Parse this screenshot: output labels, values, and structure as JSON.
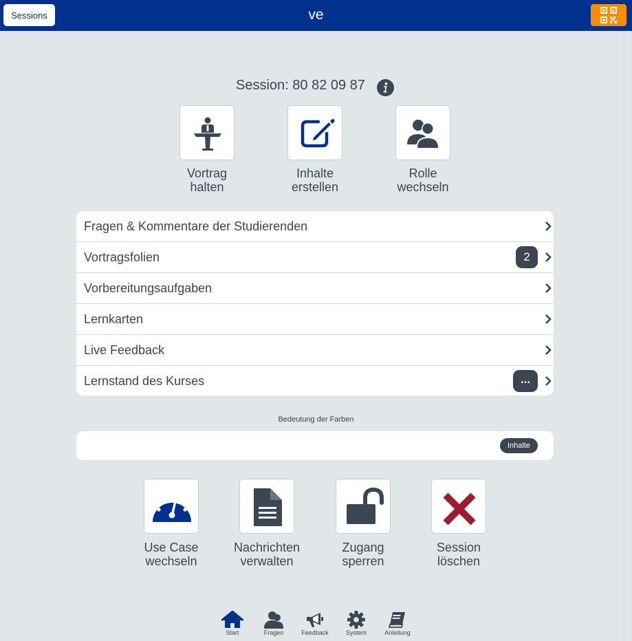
{
  "header": {
    "sessions_button": "Sessions",
    "title": "ve",
    "qr_icon": "qr-code-icon"
  },
  "session": {
    "label": "Session: 80 82 09 87",
    "info_icon": "info-icon"
  },
  "top_tiles": [
    {
      "line1": "Vortrag",
      "line2": "halten",
      "icon": "lectern-speaker-icon"
    },
    {
      "line1": "Inhalte",
      "line2": "erstellen",
      "icon": "edit-pencil-icon"
    },
    {
      "line1": "Rolle",
      "line2": "wechseln",
      "icon": "users-icon"
    }
  ],
  "menu": [
    {
      "label": "Fragen & Kommentare der Studierenden",
      "badge": ""
    },
    {
      "label": "Vortragsfolien",
      "badge": "2"
    },
    {
      "label": "Vorbereitungsaufgaben",
      "badge": ""
    },
    {
      "label": "Lernkarten",
      "badge": ""
    },
    {
      "label": "Live Feedback",
      "badge": ""
    },
    {
      "label": "Lernstand des Kurses",
      "badge": "..."
    }
  ],
  "colors_legend": {
    "caption": "Bedeutung der Farben",
    "chip": "Inhalte"
  },
  "bottom_tiles": [
    {
      "line1": "Use Case",
      "line2": "wechseln",
      "icon": "dashboard-gauge-icon"
    },
    {
      "line1": "Nachrichten",
      "line2": "verwalten",
      "icon": "document-icon"
    },
    {
      "line1": "Zugang",
      "line2": "sperren",
      "icon": "unlock-icon"
    },
    {
      "line1": "Session",
      "line2": "löschen",
      "icon": "delete-x-icon"
    }
  ],
  "footer_nav": [
    {
      "label": "Start",
      "icon": "home-icon"
    },
    {
      "label": "Fragen",
      "icon": "user-icon"
    },
    {
      "label": "Feedback",
      "icon": "megaphone-icon"
    },
    {
      "label": "System",
      "icon": "gear-icon"
    },
    {
      "label": "Anleitung",
      "icon": "book-icon"
    }
  ],
  "colors": {
    "header_bg": "#00318f",
    "qr_button_bg": "#fa8c00",
    "page_bg": "#e1e6e9",
    "text_dark": "#3a4651",
    "icon_blue": "#00318f",
    "delete_red": "#9e1b32"
  }
}
